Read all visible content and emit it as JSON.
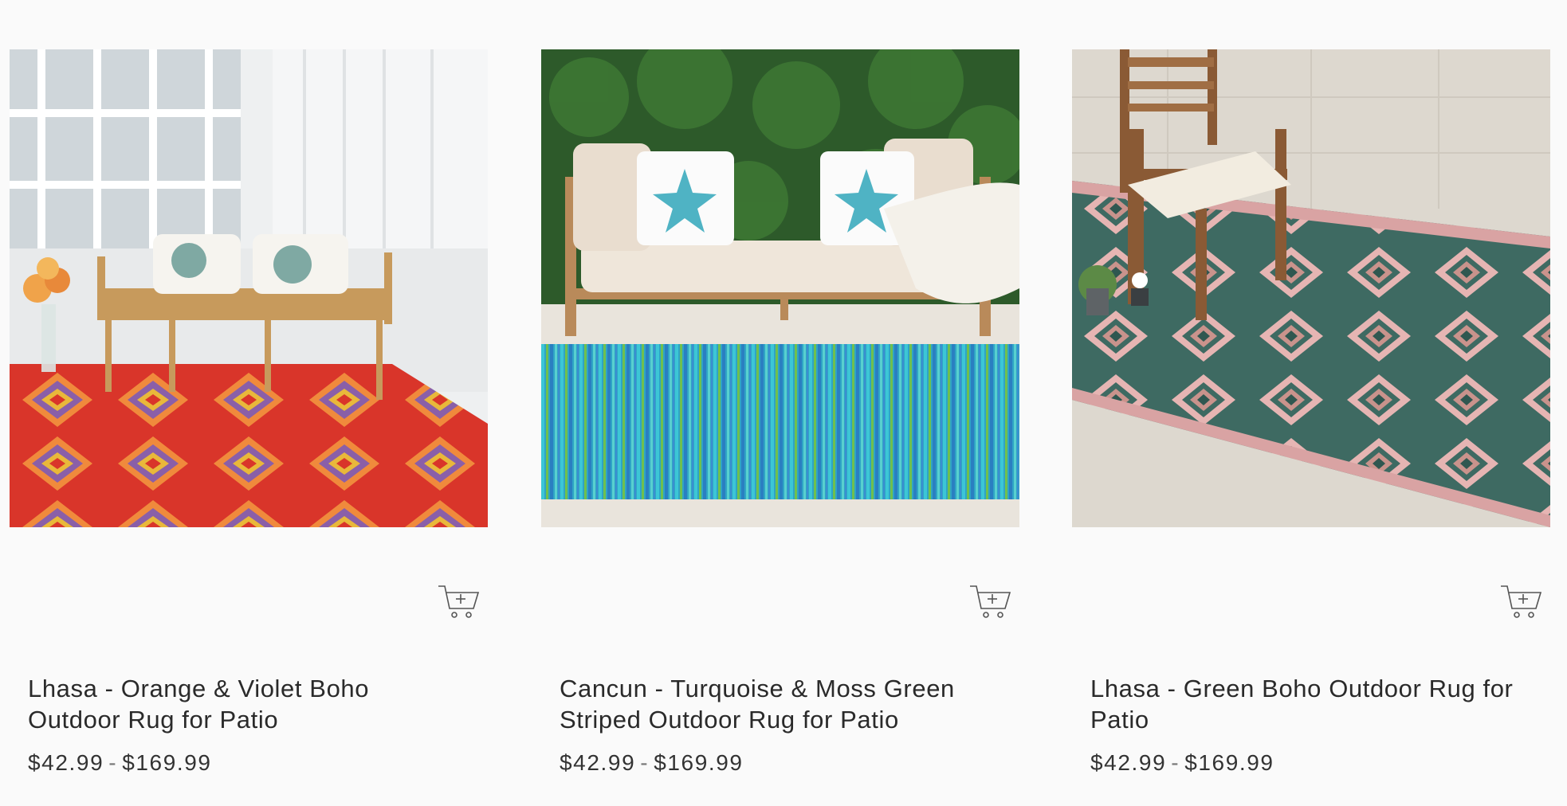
{
  "products": [
    {
      "title": "Lhasa - Orange & Violet Boho Outdoor Rug for Patio",
      "price_min": "$42.99",
      "price_sep": "-",
      "price_max": "$169.99"
    },
    {
      "title": "Cancun - Turquoise & Moss Green Striped Outdoor Rug for Patio",
      "price_min": "$42.99",
      "price_sep": "-",
      "price_max": "$169.99"
    },
    {
      "title": "Lhasa - Green Boho Outdoor Rug for Patio",
      "price_min": "$42.99",
      "price_sep": "-",
      "price_max": "$169.99"
    }
  ],
  "icons": {
    "add_to_cart": "cart-plus-icon"
  },
  "colors": {
    "background": "#fafafa",
    "text": "#2a2a2a",
    "icon_stroke": "#555555"
  }
}
